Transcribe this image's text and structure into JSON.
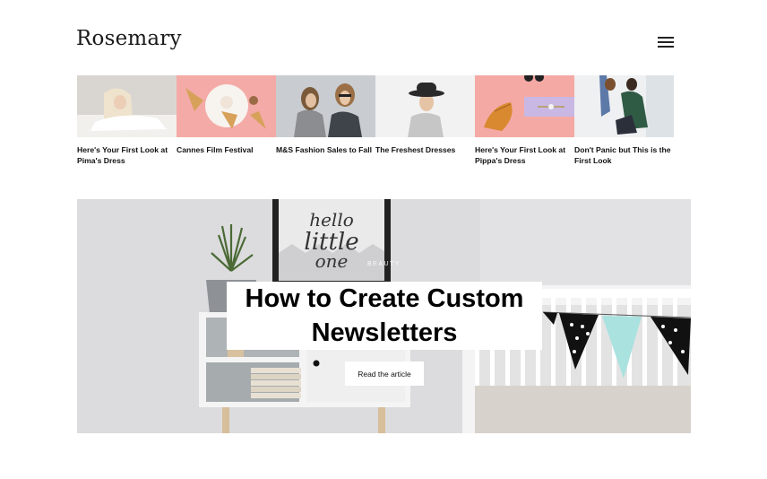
{
  "header": {
    "logo": "Rosemary",
    "menu_icon": "hamburger-menu-icon"
  },
  "strip": {
    "items": [
      {
        "title": "Here's Your First Look at Pima's Dress"
      },
      {
        "title": "Cannes Film Festival"
      },
      {
        "title": "M&S Fashion Sales to Fall"
      },
      {
        "title": "The Freshest Dresses"
      },
      {
        "title": "Here's Your First Look at Pippa's Dress"
      },
      {
        "title": "Don't Panic but This is the First Look"
      }
    ]
  },
  "hero": {
    "category": "BEAUTY",
    "title": "How to Create Custom Newsletters",
    "poster_text": "hello little one",
    "button_label": "Read the article"
  },
  "colors": {
    "text": "#111111",
    "background": "#ffffff",
    "hero_wall": "#dcdcde",
    "pink": "#f4aaa6"
  }
}
